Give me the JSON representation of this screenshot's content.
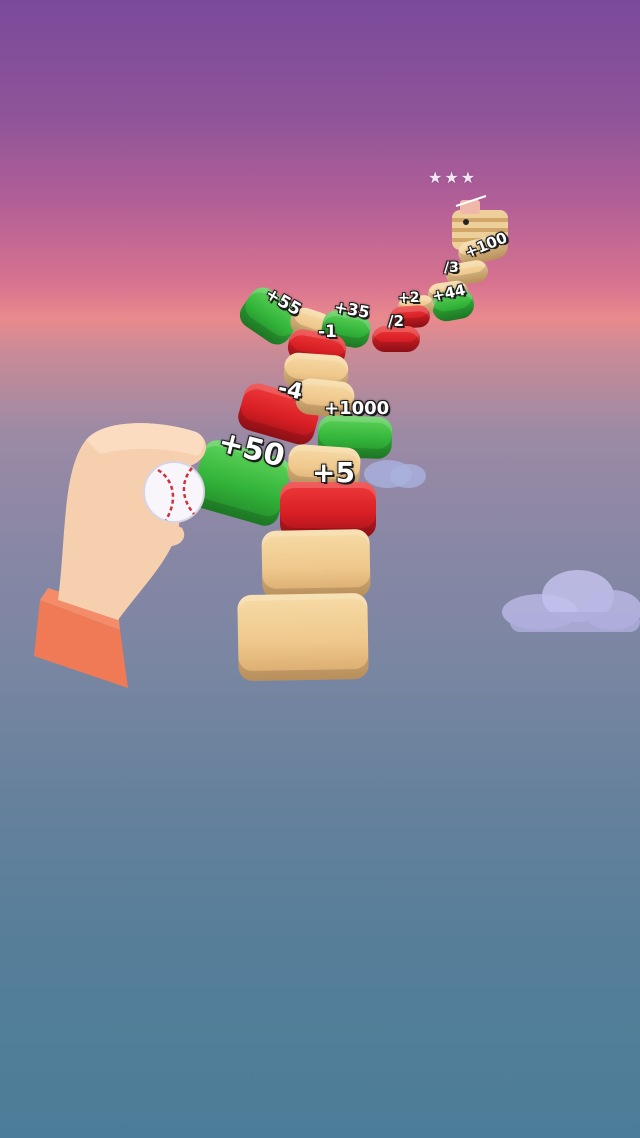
{
  "labels": {
    "plus_100": "+100",
    "div_3": "/3",
    "plus_44": "+44",
    "plus_2": "+2",
    "div_2": "/2",
    "plus_55": "+55",
    "plus_35": "+35",
    "minus_1": "-1",
    "minus_4": "-4",
    "plus_1000": "+1000",
    "plus_50": "+50",
    "plus_5": "+5"
  },
  "stars": "★★★",
  "colors": {
    "positive_tile": "#33b43a",
    "negative_tile": "#d81f25",
    "neutral_tile": "#efc88d"
  }
}
